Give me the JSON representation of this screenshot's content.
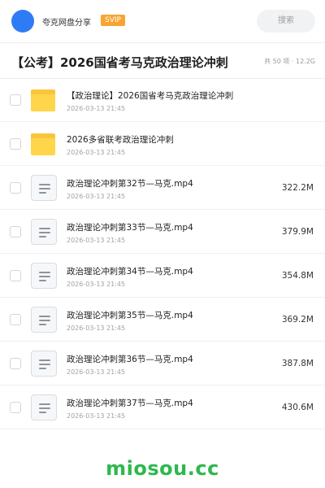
{
  "header": {
    "app_name": "夸克网盘分享",
    "badge": "SVIP",
    "search_placeholder": "搜索"
  },
  "folder": {
    "title": "【公考】2026国省考马克政治理论冲刺",
    "meta": "共 50 项 · 12.2G"
  },
  "items": [
    {
      "type": "folder",
      "icon": "folder-icon",
      "name": "【政治理论】2026国省考马克政治理论冲刺",
      "date": "2026-03-13 21:45",
      "size": ""
    },
    {
      "type": "folder",
      "icon": "folder-icon",
      "name": "2026多省联考政治理论冲刺",
      "date": "2026-03-13 21:45",
      "size": ""
    },
    {
      "type": "file",
      "icon": "file-icon",
      "name": "政治理论冲刺第32节—马克.mp4",
      "date": "2026-03-13 21:45",
      "size": "322.2M"
    },
    {
      "type": "file",
      "icon": "file-icon",
      "name": "政治理论冲刺第33节—马克.mp4",
      "date": "2026-03-13 21:45",
      "size": "379.9M"
    },
    {
      "type": "file",
      "icon": "file-icon",
      "name": "政治理论冲刺第34节—马克.mp4",
      "date": "2026-03-13 21:45",
      "size": "354.8M"
    },
    {
      "type": "file",
      "icon": "file-icon",
      "name": "政治理论冲刺第35节—马克.mp4",
      "date": "2026-03-13 21:45",
      "size": "369.2M"
    },
    {
      "type": "file",
      "icon": "file-icon",
      "name": "政治理论冲刺第36节—马克.mp4",
      "date": "2026-03-13 21:45",
      "size": "387.8M"
    },
    {
      "type": "file",
      "icon": "file-icon",
      "name": "政治理论冲刺第37节—马克.mp4",
      "date": "2026-03-13 21:45",
      "size": "430.6M"
    }
  ],
  "watermark": "miosou.cc",
  "colors": {
    "accent": "#2f7bf5",
    "badge": "#f7a530",
    "folder": "#ffd54a",
    "watermark": "#2db94d"
  }
}
